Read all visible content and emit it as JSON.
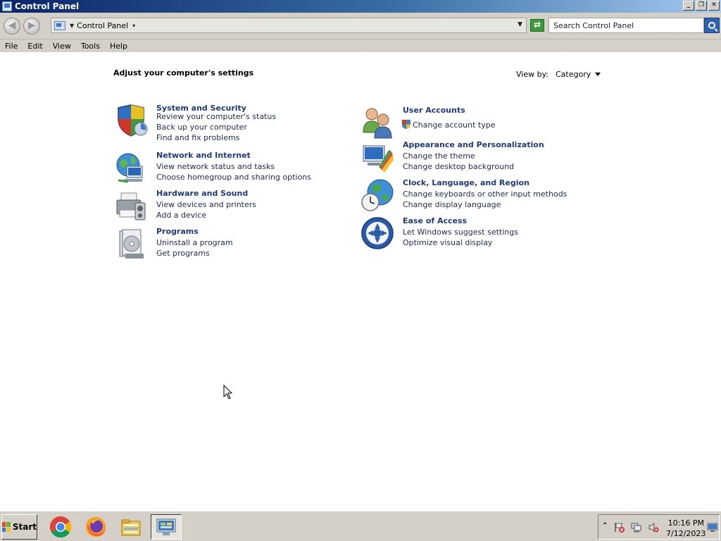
{
  "window": {
    "title": "Control Panel",
    "minimize": "_",
    "restore": "❐",
    "close": "✕"
  },
  "address": {
    "back": "◀",
    "forward": "▶",
    "caret": "▼",
    "path": "Control Panel",
    "path_caret": "▾",
    "dropdown": "▼",
    "refresh": "⇄",
    "search_placeholder": "Search Control Panel"
  },
  "menu": [
    "File",
    "Edit",
    "View",
    "Tools",
    "Help"
  ],
  "main": {
    "heading": "Adjust your computer's settings",
    "view_by_label": "View by:",
    "view_by_value": "Category"
  },
  "categories_left": [
    {
      "title": "System and Security",
      "links": [
        "Review your computer's status",
        "Back up your computer",
        "Find and fix problems"
      ]
    },
    {
      "title": "Network and Internet",
      "links": [
        "View network status and tasks",
        "Choose homegroup and sharing options"
      ]
    },
    {
      "title": "Hardware and Sound",
      "links": [
        "View devices and printers",
        "Add a device"
      ]
    },
    {
      "title": "Programs",
      "links": [
        "Uninstall a program",
        "Get programs"
      ]
    }
  ],
  "categories_right": [
    {
      "title": "User Accounts",
      "links": [
        "Change account type"
      ]
    },
    {
      "title": "Appearance and Personalization",
      "links": [
        "Change the theme",
        "Change desktop background"
      ]
    },
    {
      "title": "Clock, Language, and Region",
      "links": [
        "Change keyboards or other input methods",
        "Change display language"
      ]
    },
    {
      "title": "Ease of Access",
      "links": [
        "Let Windows suggest settings",
        "Optimize visual display"
      ]
    }
  ],
  "taskbar": {
    "start_label": "Start",
    "tray_chevron": "⌃",
    "time": "10:16 PM",
    "date": "7/12/2023"
  }
}
